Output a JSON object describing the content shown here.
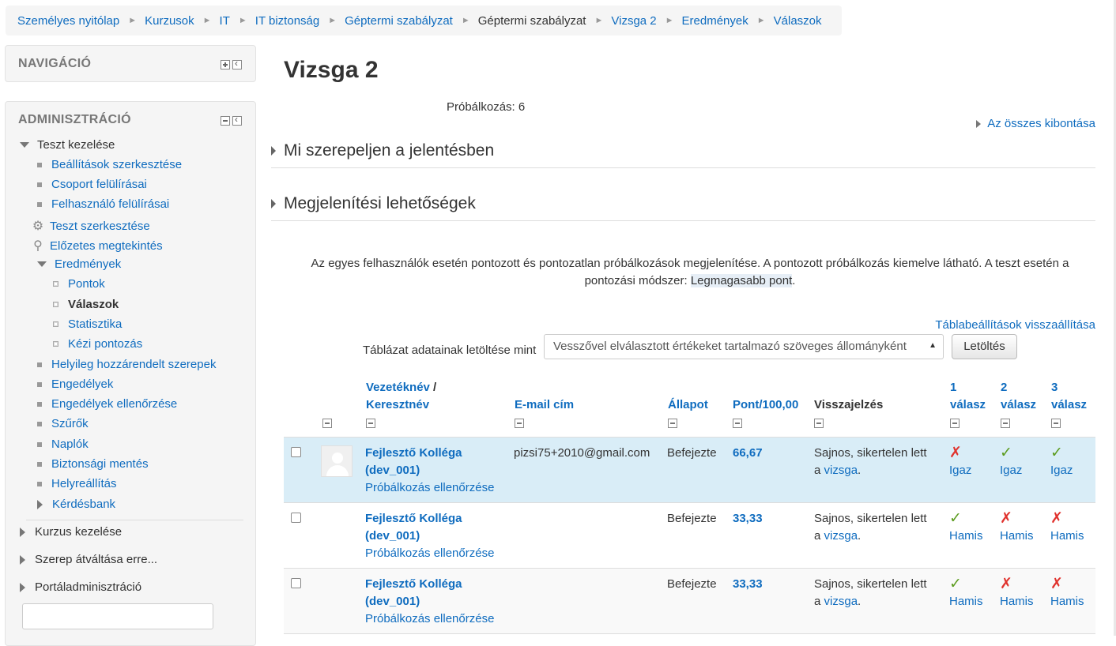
{
  "breadcrumb": [
    {
      "label": "Személyes nyitólap",
      "link": true
    },
    {
      "label": "Kurzusok",
      "link": true
    },
    {
      "label": "IT",
      "link": true
    },
    {
      "label": "IT biztonság",
      "link": true
    },
    {
      "label": "Géptermi szabályzat",
      "link": true
    },
    {
      "label": "Géptermi szabályzat",
      "link": false
    },
    {
      "label": "Vizsga 2",
      "link": true
    },
    {
      "label": "Eredmények",
      "link": true
    },
    {
      "label": "Válaszok",
      "link": true
    }
  ],
  "nav_block": {
    "title": "NAVIGÁCIÓ"
  },
  "admin_block": {
    "title": "ADMINISZTRÁCIÓ",
    "items": [
      {
        "label": "Teszt kezelése",
        "type": "expanded",
        "indent": 0,
        "link": false
      },
      {
        "label": "Beállítások szerkesztése",
        "type": "bullet",
        "indent": 1,
        "link": true
      },
      {
        "label": "Csoport felülírásai",
        "type": "bullet",
        "indent": 1,
        "link": true
      },
      {
        "label": "Felhasználó felülírásai",
        "type": "bullet",
        "indent": 1,
        "link": true
      },
      {
        "label": "Teszt szerkesztése",
        "type": "gear-icon",
        "indent": 1,
        "link": true
      },
      {
        "label": "Előzetes megtekintés",
        "type": "search-icon",
        "indent": 1,
        "link": true
      },
      {
        "label": "Eredmények",
        "type": "expanded",
        "indent": 1,
        "link": true
      },
      {
        "label": "Pontok",
        "type": "square",
        "indent": 2,
        "link": true
      },
      {
        "label": "Válaszok",
        "type": "square",
        "indent": 2,
        "link": false,
        "active": true
      },
      {
        "label": "Statisztika",
        "type": "square",
        "indent": 2,
        "link": true
      },
      {
        "label": "Kézi pontozás",
        "type": "square",
        "indent": 2,
        "link": true
      },
      {
        "label": "Helyileg hozzárendelt szerepek",
        "type": "bullet",
        "indent": 1,
        "link": true
      },
      {
        "label": "Engedélyek",
        "type": "bullet",
        "indent": 1,
        "link": true
      },
      {
        "label": "Engedélyek ellenőrzése",
        "type": "bullet",
        "indent": 1,
        "link": true
      },
      {
        "label": "Szűrők",
        "type": "bullet",
        "indent": 1,
        "link": true
      },
      {
        "label": "Naplók",
        "type": "bullet",
        "indent": 1,
        "link": true
      },
      {
        "label": "Biztonsági mentés",
        "type": "bullet",
        "indent": 1,
        "link": true
      },
      {
        "label": "Helyreállítás",
        "type": "bullet",
        "indent": 1,
        "link": true
      },
      {
        "label": "Kérdésbank",
        "type": "collapsed",
        "indent": 1,
        "link": true
      }
    ],
    "bottom_items": [
      "Kurzus kezelése",
      "Szerep átváltása erre...",
      "Portáladminisztráció"
    ]
  },
  "main": {
    "title": "Vizsga 2",
    "attempts": "Próbálkozás: 6",
    "expand_all": "Az összes kibontása",
    "sections": [
      "Mi szerepeljen a jelentésben",
      "Megjelenítési lehetőségek"
    ],
    "desc_part1": "Az egyes felhasználók esetén pontozott és pontozatlan próbálkozások megjelenítése. A pontozott próbálkozás kiemelve látható. A teszt esetén a pontozási módszer: ",
    "desc_method": "Legmagasabb pont",
    "desc_end": ".",
    "reset_link": "Táblabeállítások visszaállítása",
    "download_label": "Táblázat adatainak letöltése mint",
    "download_select": "Vesszővel elválasztott értékeket tartalmazó szöveges állományként",
    "download_button": "Letöltés"
  },
  "table": {
    "headers": {
      "lastname": "Vezetéknév",
      "slash": " /",
      "firstname": "Keresztnév",
      "email": "E-mail cím",
      "state": "Állapot",
      "grade": "Pont/100,00",
      "feedback": "Visszajelzés",
      "r1a": "1",
      "r1b": "válasz",
      "r2a": "2",
      "r2b": "válasz",
      "r3a": "3",
      "r3b": "válasz"
    },
    "rows": [
      {
        "name1": "Fejlesztő Kolléga",
        "name2": "(dev_001)",
        "review": "Próbálkozás ellenőrzése",
        "email": "pizsi75+2010@gmail.com",
        "state": "Befejezte",
        "grade": "66,67",
        "feedback1": "Sajnos, sikertelen lett",
        "feedback2a": "a ",
        "feedback2link": "vizsga",
        "feedback2b": ".",
        "responses": [
          {
            "mark": "✗",
            "ok": false,
            "text": "Igaz"
          },
          {
            "mark": "✓",
            "ok": true,
            "text": "Igaz"
          },
          {
            "mark": "✓",
            "ok": true,
            "text": "Igaz"
          }
        ]
      },
      {
        "name1": "Fejlesztő Kolléga",
        "name2": "(dev_001)",
        "review": "Próbálkozás ellenőrzése",
        "email": "",
        "state": "Befejezte",
        "grade": "33,33",
        "feedback1": "Sajnos, sikertelen lett",
        "feedback2a": "a ",
        "feedback2link": "vizsga",
        "feedback2b": ".",
        "responses": [
          {
            "mark": "✓",
            "ok": true,
            "text": "Hamis"
          },
          {
            "mark": "✗",
            "ok": false,
            "text": "Hamis"
          },
          {
            "mark": "✗",
            "ok": false,
            "text": "Hamis"
          }
        ]
      },
      {
        "name1": "Fejlesztő Kolléga",
        "name2": "(dev_001)",
        "review": "Próbálkozás ellenőrzése",
        "email": "",
        "state": "Befejezte",
        "grade": "33,33",
        "feedback1": "Sajnos, sikertelen lett",
        "feedback2a": "a ",
        "feedback2link": "vizsga",
        "feedback2b": ".",
        "responses": [
          {
            "mark": "✓",
            "ok": true,
            "text": "Hamis"
          },
          {
            "mark": "✗",
            "ok": false,
            "text": "Hamis"
          },
          {
            "mark": "✗",
            "ok": false,
            "text": "Hamis"
          }
        ]
      }
    ]
  },
  "colors": {
    "link": "#0f6cbf",
    "selected_row": "#d9edf7",
    "ok": "#5c9c1f",
    "bad": "#e0322d"
  }
}
